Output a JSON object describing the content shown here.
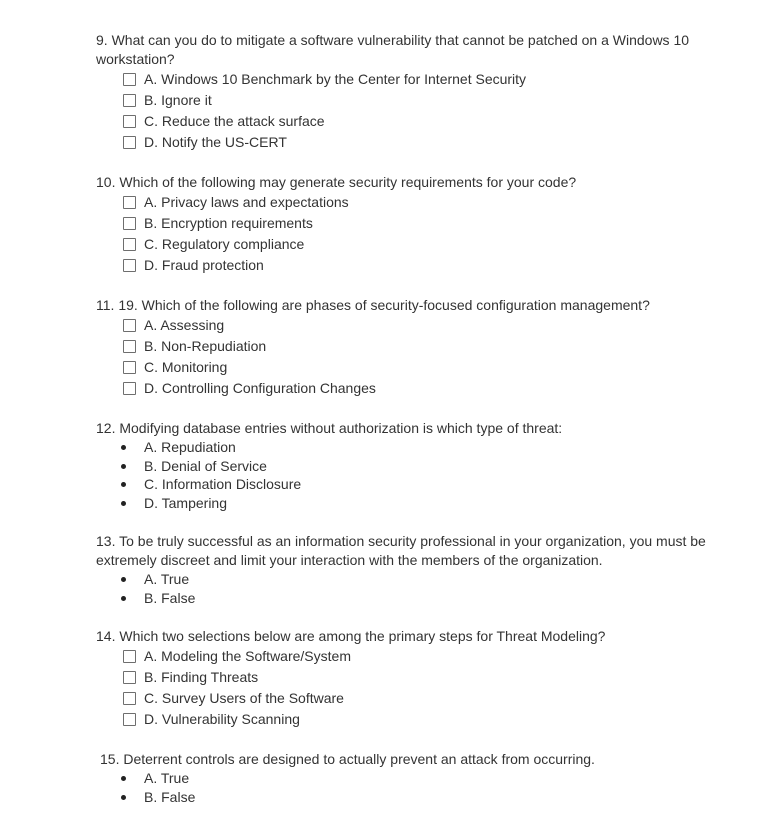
{
  "questions": [
    {
      "number": "9.",
      "text": "What can you do to mitigate a software vulnerability that cannot be patched on a Windows 10 workstation?",
      "type": "checkbox",
      "options": [
        "A. Windows 10 Benchmark by the Center for Internet Security",
        "B. Ignore it",
        "C. Reduce the attack surface",
        "D. Notify the US-CERT"
      ]
    },
    {
      "number": "10.",
      "text": "Which of the following may generate security requirements for your code?",
      "type": "checkbox",
      "options": [
        "A. Privacy laws and expectations",
        "B. Encryption requirements",
        "C. Regulatory compliance",
        "D. Fraud protection"
      ]
    },
    {
      "number": "11.",
      "text": "19. Which of the following are phases of security-focused configuration management?",
      "type": "checkbox",
      "options": [
        "A. Assessing",
        "B. Non-Repudiation",
        "C. Monitoring",
        "D. Controlling Configuration Changes"
      ]
    },
    {
      "number": "12.",
      "text": "Modifying database entries without authorization is which type of threat:",
      "type": "bullet",
      "options": [
        "A. Repudiation",
        "B. Denial of Service",
        "C. Information Disclosure",
        "D. Tampering"
      ]
    },
    {
      "number": "13.",
      "text": "To be truly successful as an information security professional in your organization, you must be extremely discreet and limit your interaction with the members of the organization.",
      "type": "bullet",
      "options": [
        "A. True",
        "B. False"
      ]
    },
    {
      "number": "14.",
      "text": "Which two selections below are among the primary steps for Threat Modeling?",
      "type": "checkbox",
      "options": [
        "A. Modeling the Software/System",
        "B. Finding Threats",
        "C. Survey Users of the Software",
        "D. Vulnerability Scanning"
      ]
    },
    {
      "number": "15.",
      "text": "Deterrent controls are designed to actually prevent an attack from occurring.",
      "type": "bullet",
      "options": [
        "A. True",
        "B. False"
      ]
    }
  ]
}
